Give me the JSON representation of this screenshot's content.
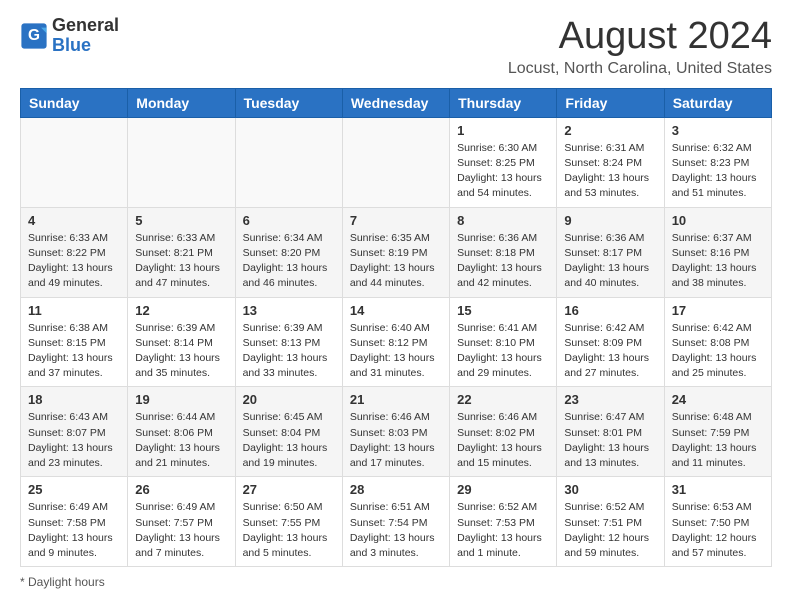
{
  "header": {
    "logo_general": "General",
    "logo_blue": "Blue",
    "title": "August 2024",
    "subtitle": "Locust, North Carolina, United States"
  },
  "weekdays": [
    "Sunday",
    "Monday",
    "Tuesday",
    "Wednesday",
    "Thursday",
    "Friday",
    "Saturday"
  ],
  "weeks": [
    [
      {
        "day": "",
        "info": ""
      },
      {
        "day": "",
        "info": ""
      },
      {
        "day": "",
        "info": ""
      },
      {
        "day": "",
        "info": ""
      },
      {
        "day": "1",
        "info": "Sunrise: 6:30 AM\nSunset: 8:25 PM\nDaylight: 13 hours\nand 54 minutes."
      },
      {
        "day": "2",
        "info": "Sunrise: 6:31 AM\nSunset: 8:24 PM\nDaylight: 13 hours\nand 53 minutes."
      },
      {
        "day": "3",
        "info": "Sunrise: 6:32 AM\nSunset: 8:23 PM\nDaylight: 13 hours\nand 51 minutes."
      }
    ],
    [
      {
        "day": "4",
        "info": "Sunrise: 6:33 AM\nSunset: 8:22 PM\nDaylight: 13 hours\nand 49 minutes."
      },
      {
        "day": "5",
        "info": "Sunrise: 6:33 AM\nSunset: 8:21 PM\nDaylight: 13 hours\nand 47 minutes."
      },
      {
        "day": "6",
        "info": "Sunrise: 6:34 AM\nSunset: 8:20 PM\nDaylight: 13 hours\nand 46 minutes."
      },
      {
        "day": "7",
        "info": "Sunrise: 6:35 AM\nSunset: 8:19 PM\nDaylight: 13 hours\nand 44 minutes."
      },
      {
        "day": "8",
        "info": "Sunrise: 6:36 AM\nSunset: 8:18 PM\nDaylight: 13 hours\nand 42 minutes."
      },
      {
        "day": "9",
        "info": "Sunrise: 6:36 AM\nSunset: 8:17 PM\nDaylight: 13 hours\nand 40 minutes."
      },
      {
        "day": "10",
        "info": "Sunrise: 6:37 AM\nSunset: 8:16 PM\nDaylight: 13 hours\nand 38 minutes."
      }
    ],
    [
      {
        "day": "11",
        "info": "Sunrise: 6:38 AM\nSunset: 8:15 PM\nDaylight: 13 hours\nand 37 minutes."
      },
      {
        "day": "12",
        "info": "Sunrise: 6:39 AM\nSunset: 8:14 PM\nDaylight: 13 hours\nand 35 minutes."
      },
      {
        "day": "13",
        "info": "Sunrise: 6:39 AM\nSunset: 8:13 PM\nDaylight: 13 hours\nand 33 minutes."
      },
      {
        "day": "14",
        "info": "Sunrise: 6:40 AM\nSunset: 8:12 PM\nDaylight: 13 hours\nand 31 minutes."
      },
      {
        "day": "15",
        "info": "Sunrise: 6:41 AM\nSunset: 8:10 PM\nDaylight: 13 hours\nand 29 minutes."
      },
      {
        "day": "16",
        "info": "Sunrise: 6:42 AM\nSunset: 8:09 PM\nDaylight: 13 hours\nand 27 minutes."
      },
      {
        "day": "17",
        "info": "Sunrise: 6:42 AM\nSunset: 8:08 PM\nDaylight: 13 hours\nand 25 minutes."
      }
    ],
    [
      {
        "day": "18",
        "info": "Sunrise: 6:43 AM\nSunset: 8:07 PM\nDaylight: 13 hours\nand 23 minutes."
      },
      {
        "day": "19",
        "info": "Sunrise: 6:44 AM\nSunset: 8:06 PM\nDaylight: 13 hours\nand 21 minutes."
      },
      {
        "day": "20",
        "info": "Sunrise: 6:45 AM\nSunset: 8:04 PM\nDaylight: 13 hours\nand 19 minutes."
      },
      {
        "day": "21",
        "info": "Sunrise: 6:46 AM\nSunset: 8:03 PM\nDaylight: 13 hours\nand 17 minutes."
      },
      {
        "day": "22",
        "info": "Sunrise: 6:46 AM\nSunset: 8:02 PM\nDaylight: 13 hours\nand 15 minutes."
      },
      {
        "day": "23",
        "info": "Sunrise: 6:47 AM\nSunset: 8:01 PM\nDaylight: 13 hours\nand 13 minutes."
      },
      {
        "day": "24",
        "info": "Sunrise: 6:48 AM\nSunset: 7:59 PM\nDaylight: 13 hours\nand 11 minutes."
      }
    ],
    [
      {
        "day": "25",
        "info": "Sunrise: 6:49 AM\nSunset: 7:58 PM\nDaylight: 13 hours\nand 9 minutes."
      },
      {
        "day": "26",
        "info": "Sunrise: 6:49 AM\nSunset: 7:57 PM\nDaylight: 13 hours\nand 7 minutes."
      },
      {
        "day": "27",
        "info": "Sunrise: 6:50 AM\nSunset: 7:55 PM\nDaylight: 13 hours\nand 5 minutes."
      },
      {
        "day": "28",
        "info": "Sunrise: 6:51 AM\nSunset: 7:54 PM\nDaylight: 13 hours\nand 3 minutes."
      },
      {
        "day": "29",
        "info": "Sunrise: 6:52 AM\nSunset: 7:53 PM\nDaylight: 13 hours\nand 1 minute."
      },
      {
        "day": "30",
        "info": "Sunrise: 6:52 AM\nSunset: 7:51 PM\nDaylight: 12 hours\nand 59 minutes."
      },
      {
        "day": "31",
        "info": "Sunrise: 6:53 AM\nSunset: 7:50 PM\nDaylight: 12 hours\nand 57 minutes."
      }
    ]
  ],
  "footer": {
    "daylight_label": "Daylight hours"
  }
}
